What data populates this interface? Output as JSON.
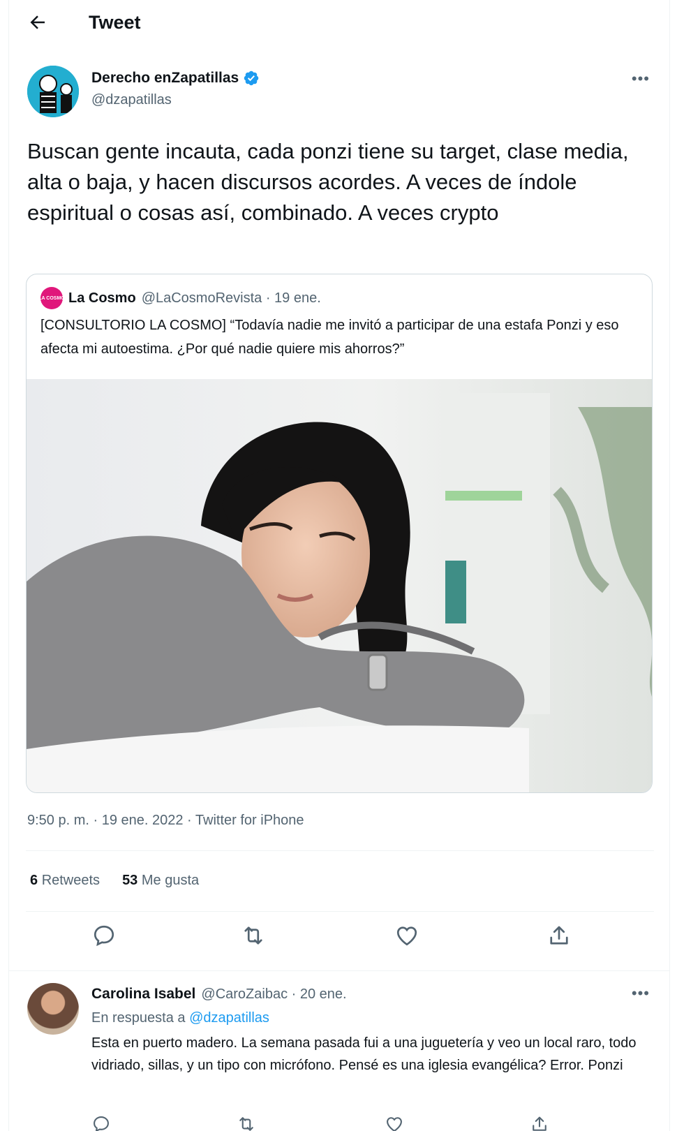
{
  "header": {
    "title": "Tweet",
    "back_icon": "arrow-left-icon"
  },
  "tweet": {
    "author_name": "Derecho enZapatillas",
    "author_handle": "@dzapatillas",
    "verified": true,
    "more_label": "•••",
    "text": "Buscan gente incauta, cada ponzi tiene su target, clase media, alta o baja, y hacen discursos acordes. A veces de índole espiritual o cosas así, combinado. A veces crypto",
    "timestamp": "9:50 p. m. · 19 ene. 2022 · Twitter for iPhone",
    "stats": {
      "retweets_count": "6",
      "retweets_label": "Retweets",
      "likes_count": "53",
      "likes_label": "Me gusta"
    }
  },
  "quoted": {
    "avatar_text": "LA COSMO",
    "name": "La Cosmo",
    "meta": "@LaCosmoRevista · 19 ene.",
    "text": "[CONSULTORIO LA COSMO] “Todavía nadie me invitó a participar de una estafa Ponzi y eso afecta mi autoestima. ¿Por qué nadie quiere mis ahorros?”"
  },
  "reply": {
    "name": "Carolina Isabel",
    "meta": "@CaroZaibac · 20 ene.",
    "more_label": "•••",
    "reply_prefix": "En respuesta a",
    "reply_handle": "@dzapatillas",
    "text": "Esta en puerto madero. La semana pasada fui a una juguetería y veo un local raro, todo vidriado, sillas, y un tipo con micrófono. Pensé es una iglesia evangélica? Error. Ponzi"
  },
  "colors": {
    "accent": "#1d9bf0",
    "text": "#0f1419",
    "secondary": "#536471",
    "border": "#cfd9de"
  }
}
